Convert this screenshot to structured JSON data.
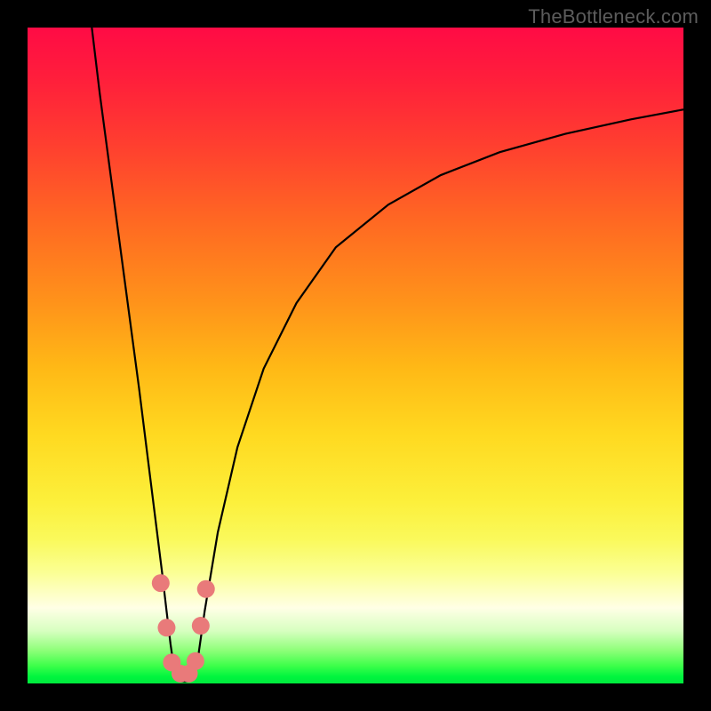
{
  "watermark": "TheBottleneck.com",
  "colors": {
    "frame": "#000000",
    "watermark_text": "#5c5c5c",
    "curve": "#000000",
    "marker": "#e97a7a",
    "gradient_top": "#ff0b45",
    "gradient_bottom": "#00ea3d"
  },
  "chart_data": {
    "type": "line",
    "title": "",
    "xlabel": "",
    "ylabel": "",
    "xlim": [
      0,
      100
    ],
    "ylim": [
      0,
      100
    ],
    "grid": false,
    "legend": false,
    "annotations": [],
    "series": [
      {
        "name": "left-branch",
        "x": [
          9.8,
          11,
          13,
          15,
          17,
          18.5,
          19.5,
          20.5,
          21.2,
          21.8,
          22.3,
          22.7
        ],
        "y": [
          100,
          90,
          75,
          60,
          45,
          33,
          25,
          17,
          11,
          6,
          2.5,
          0.6
        ]
      },
      {
        "name": "right-branch",
        "x": [
          25.3,
          26,
          27,
          29,
          32,
          36,
          41,
          47,
          55,
          63,
          72,
          82,
          92,
          100
        ],
        "y": [
          0.6,
          4,
          11,
          23,
          36,
          48,
          58,
          66.5,
          73,
          77.5,
          81,
          83.8,
          86,
          87.5
        ]
      },
      {
        "name": "valley-floor",
        "x": [
          22.7,
          23.5,
          24.4,
          25.3
        ],
        "y": [
          0.6,
          0.3,
          0.3,
          0.6
        ]
      }
    ],
    "markers": [
      {
        "name": "m1",
        "x": 20.3,
        "y": 15.3
      },
      {
        "name": "m2",
        "x": 21.2,
        "y": 8.5
      },
      {
        "name": "m3",
        "x": 22.0,
        "y": 3.2
      },
      {
        "name": "m4",
        "x": 23.3,
        "y": 1.5
      },
      {
        "name": "m5",
        "x": 24.6,
        "y": 1.5
      },
      {
        "name": "m6",
        "x": 25.6,
        "y": 3.4
      },
      {
        "name": "m7",
        "x": 26.4,
        "y": 8.8
      },
      {
        "name": "m8",
        "x": 27.2,
        "y": 14.4
      }
    ],
    "marker_radius_px": 10
  }
}
